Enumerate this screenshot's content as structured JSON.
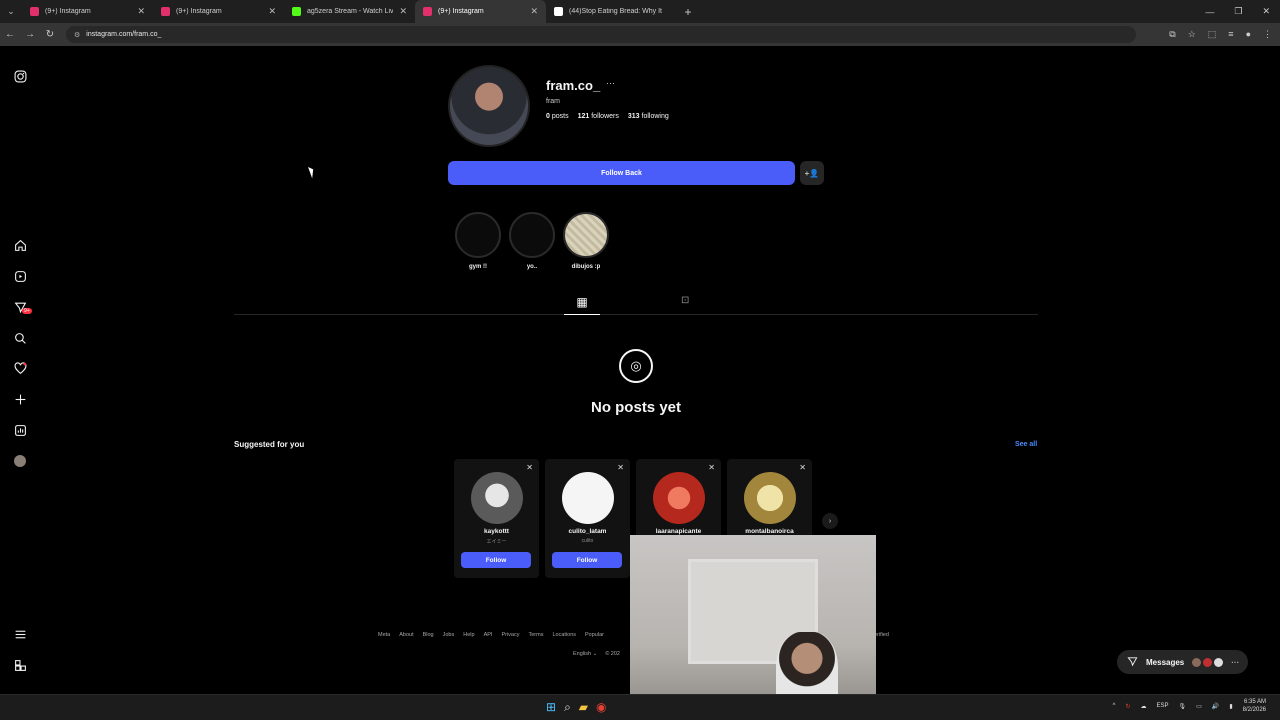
{
  "browser": {
    "tabs": [
      {
        "title": "(9+) Instagram",
        "favicon_color": "#e1306c",
        "active": false
      },
      {
        "title": "(9+) Instagram",
        "favicon_color": "#e1306c",
        "active": false
      },
      {
        "title": "ag5zera Stream - Watch Live o",
        "favicon_color": "#53fc18",
        "active": false
      },
      {
        "title": "(9+) Instagram",
        "favicon_color": "#e1306c",
        "active": true
      },
      {
        "title": "(44)Stop Eating Bread: Why It",
        "favicon_color": "#ffffff",
        "active": false
      }
    ],
    "url": "instagram.com/fram.co_"
  },
  "sidebar": {
    "icons": [
      "instagram-icon",
      "home-icon",
      "reels-icon",
      "messages-icon",
      "search-icon",
      "notifications-icon",
      "create-icon",
      "dashboard-icon",
      "profile-icon",
      "menu-icon",
      "threads-icon"
    ],
    "messages_badge": "9+"
  },
  "profile": {
    "username": "fram.co_",
    "fullname": "fram",
    "posts_count": "0",
    "posts_label": "posts",
    "followers_count": "121",
    "followers_label": "followers",
    "following_count": "313",
    "following_label": "following",
    "follow_back_label": "Follow Back"
  },
  "highlights": [
    {
      "label": "gym !!"
    },
    {
      "label": "yo.."
    },
    {
      "label": "dibujos :p"
    }
  ],
  "empty_state": {
    "title": "No posts yet"
  },
  "suggested": {
    "title": "Suggested for you",
    "see_all": "See all",
    "follow_label": "Follow",
    "cards": [
      {
        "username": "kaykottt",
        "subtitle": "エイミー",
        "color": "#c9c9c9"
      },
      {
        "username": "culito_latam",
        "subtitle": "culito",
        "color": "#f5f5f5"
      },
      {
        "username": "laaranapicante",
        "subtitle": "",
        "color": "#d8483a"
      },
      {
        "username": "montalbanoirca",
        "subtitle": "",
        "color": "#d7c47a"
      }
    ]
  },
  "footer": {
    "links": [
      "Meta",
      "About",
      "Blog",
      "Jobs",
      "Help",
      "API",
      "Privacy",
      "Terms",
      "Locations",
      "Popular"
    ],
    "verified_fragment": "erified",
    "language": "English",
    "copyright_fragment": "© 202"
  },
  "messages_widget": {
    "label": "Messages",
    "badge": "9+"
  },
  "taskbar": {
    "language": "ESP",
    "time": "6:35 AM",
    "date": "8/2/2026"
  }
}
